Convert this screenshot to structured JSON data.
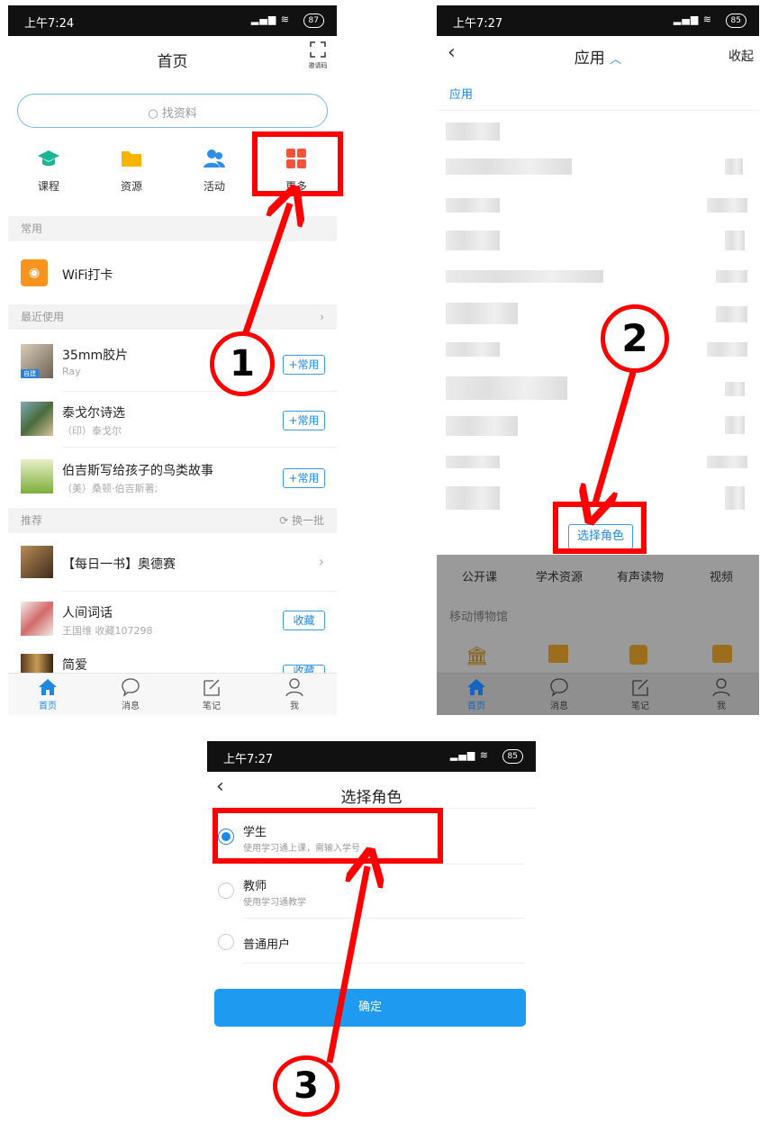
{
  "screen1": {
    "status": {
      "time": "上午7:24",
      "signal": ".ııl",
      "battery": "87"
    },
    "header": {
      "title": "首页",
      "invite_label": "邀请码"
    },
    "search": {
      "placeholder": "找资料"
    },
    "quick": [
      {
        "label": "课程",
        "icon": "graduation-cap-icon"
      },
      {
        "label": "资源",
        "icon": "folder-icon"
      },
      {
        "label": "活动",
        "icon": "people-icon"
      },
      {
        "label": "更多",
        "icon": "grid-icon"
      }
    ],
    "section_common": "常用",
    "wifi_label": "WiFi打卡",
    "section_recent": "最近使用",
    "recent": [
      {
        "title": "35mm胶片",
        "sub": "Ray",
        "btn": "+常用",
        "cover_tag": "自建"
      },
      {
        "title": "泰戈尔诗选",
        "sub": "（印）泰戈尔",
        "btn": "+常用"
      },
      {
        "title": "伯吉斯写给孩子的鸟类故事",
        "sub": "（美）桑顿·伯吉斯著;",
        "btn": "+常用"
      }
    ],
    "section_recommend": "推荐",
    "refresh": "换一批",
    "recommend": [
      {
        "title": "【每日一书】奥德赛",
        "sub": "",
        "btn": ""
      },
      {
        "title": "人间词话",
        "sub": "王国维 收藏107298",
        "btn": "收藏"
      },
      {
        "title": "简爱",
        "sub": "",
        "btn": "收藏"
      }
    ],
    "tabs": [
      "首页",
      "消息",
      "笔记",
      "我"
    ]
  },
  "screen2": {
    "status": {
      "time": "上午7:27",
      "battery": "85"
    },
    "header": {
      "title": "应用",
      "right": "收起"
    },
    "section": "应用",
    "role_button": "选择角色",
    "categories": [
      "公开课",
      "学术资源",
      "有声读物",
      "视频"
    ],
    "museum": "移动博物馆",
    "tabs": [
      "首页",
      "消息",
      "笔记",
      "我"
    ]
  },
  "screen3": {
    "status": {
      "time": "上午7:27",
      "battery": "85"
    },
    "header": {
      "title": "选择角色"
    },
    "roles": [
      {
        "label": "学生",
        "desc": "使用学习通上课，需输入学号",
        "selected": true
      },
      {
        "label": "教师",
        "desc": "使用学习通教学",
        "selected": false
      },
      {
        "label": "普通用户",
        "desc": "",
        "selected": false
      }
    ],
    "confirm": "确定"
  },
  "annotations": [
    "1",
    "2",
    "3"
  ],
  "colors": {
    "accent": "#1e88e5",
    "annotation": "#ff0000",
    "course": "#1bb596",
    "resource": "#f7b500",
    "activity": "#2d8ee8",
    "more": "#f2533d",
    "wifi": "#f7941d"
  }
}
